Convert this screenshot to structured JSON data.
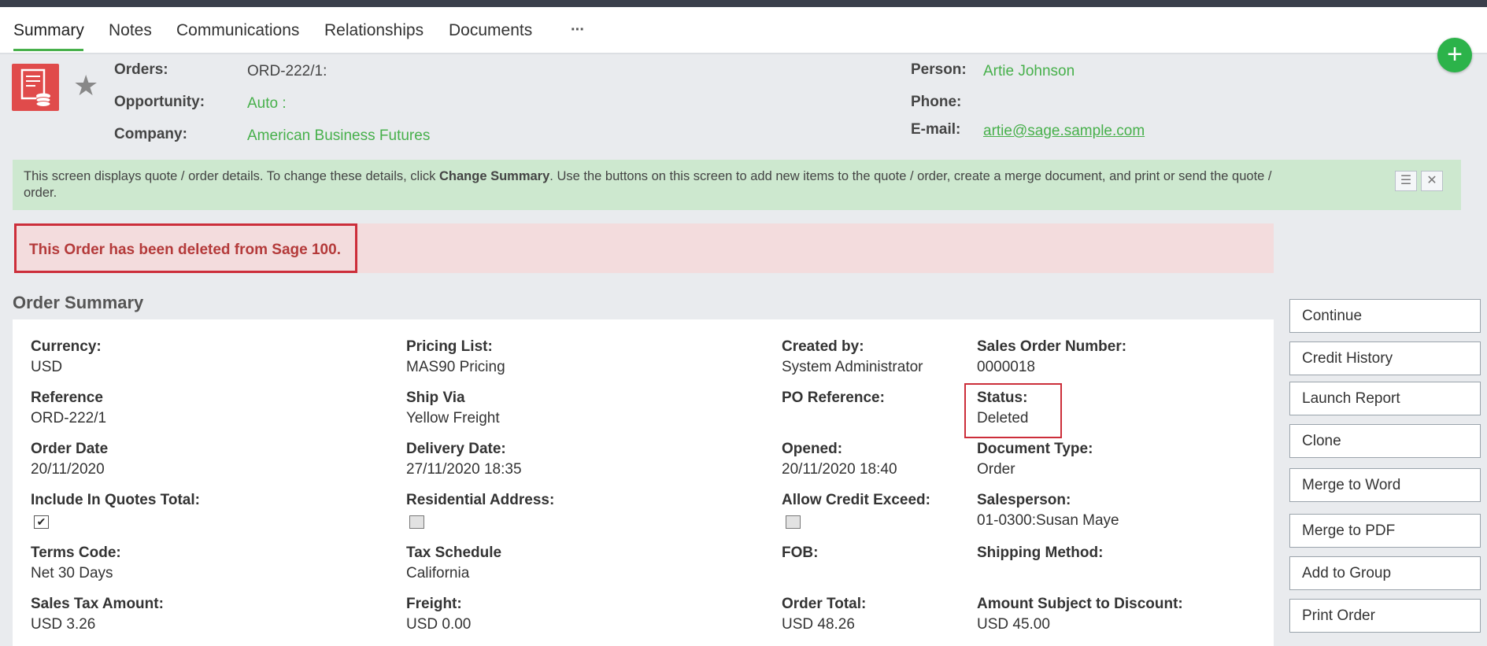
{
  "tabs": [
    "Summary",
    "Notes",
    "Communications",
    "Relationships",
    "Documents"
  ],
  "more_label": "···",
  "add_icon": "+",
  "header": {
    "orders_label": "Orders:",
    "orders_value": "ORD-222/1:",
    "opportunity_label": "Opportunity:",
    "opportunity_value": "Auto :",
    "company_label": "Company:",
    "company_value": "American Business Futures",
    "person_label": "Person:",
    "person_value": "Artie Johnson",
    "phone_label": "Phone:",
    "email_label": "E-mail:",
    "email_value": "artie@sage.sample.com"
  },
  "info": {
    "text_before": "This screen displays quote / order details. To change these details, click ",
    "text_bold": "Change Summary",
    "text_after": ". Use the buttons on this screen to add new items to the quote / order, create a merge document, and print or send the quote / order."
  },
  "alert": "This Order has been deleted from Sage 100.",
  "section_title": "Order Summary",
  "fields": {
    "currency_label": "Currency:",
    "currency_value": "USD",
    "pricing_label": "Pricing List:",
    "pricing_value": "MAS90 Pricing",
    "createdby_label": "Created by:",
    "createdby_value": "System Administrator",
    "sonum_label": "Sales Order Number:",
    "sonum_value": "0000018",
    "reference_label": "Reference",
    "reference_value": "ORD-222/1",
    "shipvia_label": "Ship Via",
    "shipvia_value": "Yellow Freight",
    "poref_label": "PO Reference:",
    "status_label": "Status:",
    "status_value": "Deleted",
    "orderdate_label": "Order Date",
    "orderdate_value": "20/11/2020",
    "delivery_label": "Delivery Date:",
    "delivery_value": "27/11/2020 18:35",
    "opened_label": "Opened:",
    "opened_value": "20/11/2020 18:40",
    "doctype_label": "Document Type:",
    "doctype_value": "Order",
    "includequotes_label": "Include In Quotes Total:",
    "residential_label": "Residential Address:",
    "allowcredit_label": "Allow Credit Exceed:",
    "salesperson_label": "Salesperson:",
    "salesperson_value": "01-0300:Susan Maye",
    "terms_label": "Terms Code:",
    "terms_value": "Net 30 Days",
    "taxschedule_label": "Tax Schedule",
    "taxschedule_value": "California",
    "fob_label": "FOB:",
    "shipmethod_label": "Shipping Method:",
    "salestax_label": "Sales Tax Amount:",
    "salestax_value": "USD 3.26",
    "freight_label": "Freight:",
    "freight_value": "USD 0.00",
    "ordertotal_label": "Order Total:",
    "ordertotal_value": "USD 48.26",
    "discount_label": "Amount Subject to Discount:",
    "discount_value": "USD 45.00"
  },
  "buttons": [
    "Continue",
    "Credit History",
    "Launch Report",
    "Clone",
    "Merge to Word",
    "Merge to PDF",
    "Add to Group",
    "Print Order"
  ],
  "colors": {
    "accent": "#47b04b",
    "alert": "#cc2e3a",
    "info_bg": "#cde8cf"
  }
}
